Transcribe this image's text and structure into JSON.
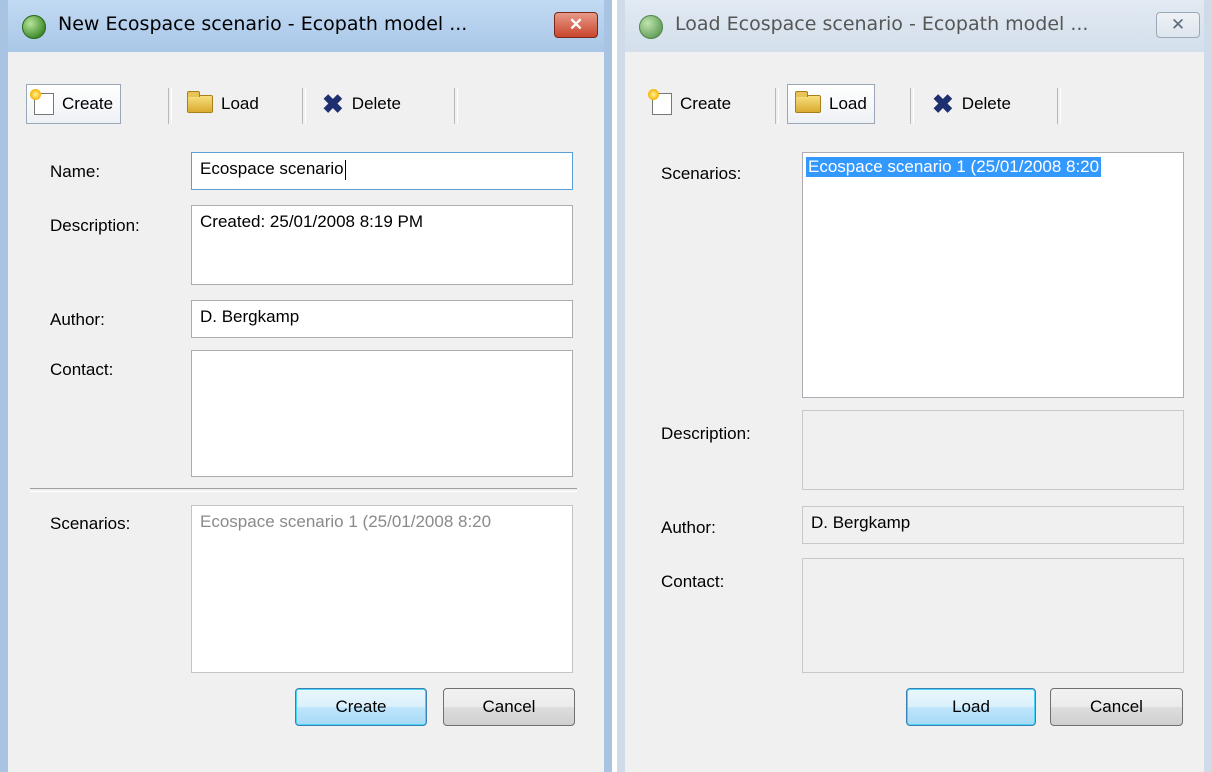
{
  "left_window": {
    "title": "New Ecospace scenario - Ecopath model ...",
    "close_label": "✕",
    "toolbar": {
      "create": "Create",
      "load": "Load",
      "delete": "Delete"
    },
    "form": {
      "name_label": "Name:",
      "name_value": "Ecospace scenario",
      "description_label": "Description:",
      "description_value": "Created: 25/01/2008 8:19 PM",
      "author_label": "Author:",
      "author_value": "D. Bergkamp",
      "contact_label": "Contact:",
      "contact_value": "",
      "scenarios_label": "Scenarios:",
      "scenarios_items": [
        "Ecospace scenario 1 (25/01/2008 8:20"
      ]
    },
    "buttons": {
      "ok": "Create",
      "cancel": "Cancel"
    }
  },
  "right_window": {
    "title": "Load Ecospace scenario - Ecopath model ...",
    "close_label": "✕",
    "toolbar": {
      "create": "Create",
      "load": "Load",
      "delete": "Delete"
    },
    "form": {
      "scenarios_label": "Scenarios:",
      "scenarios_items": [
        "Ecospace scenario 1 (25/01/2008 8:20"
      ],
      "description_label": "Description:",
      "description_value": "",
      "author_label": "Author:",
      "author_value": "D. Bergkamp",
      "contact_label": "Contact:",
      "contact_value": ""
    },
    "buttons": {
      "ok": "Load",
      "cancel": "Cancel"
    }
  },
  "icons": {
    "app": "globe-icon",
    "create": "new-document-icon",
    "load": "open-folder-icon",
    "delete": "delete-x-icon"
  },
  "colors": {
    "active_titlebar": "#a9c7e8",
    "inactive_titlebar": "#d3dfeb",
    "selection": "#3399ff",
    "dialog_bg": "#f0f0f0"
  }
}
